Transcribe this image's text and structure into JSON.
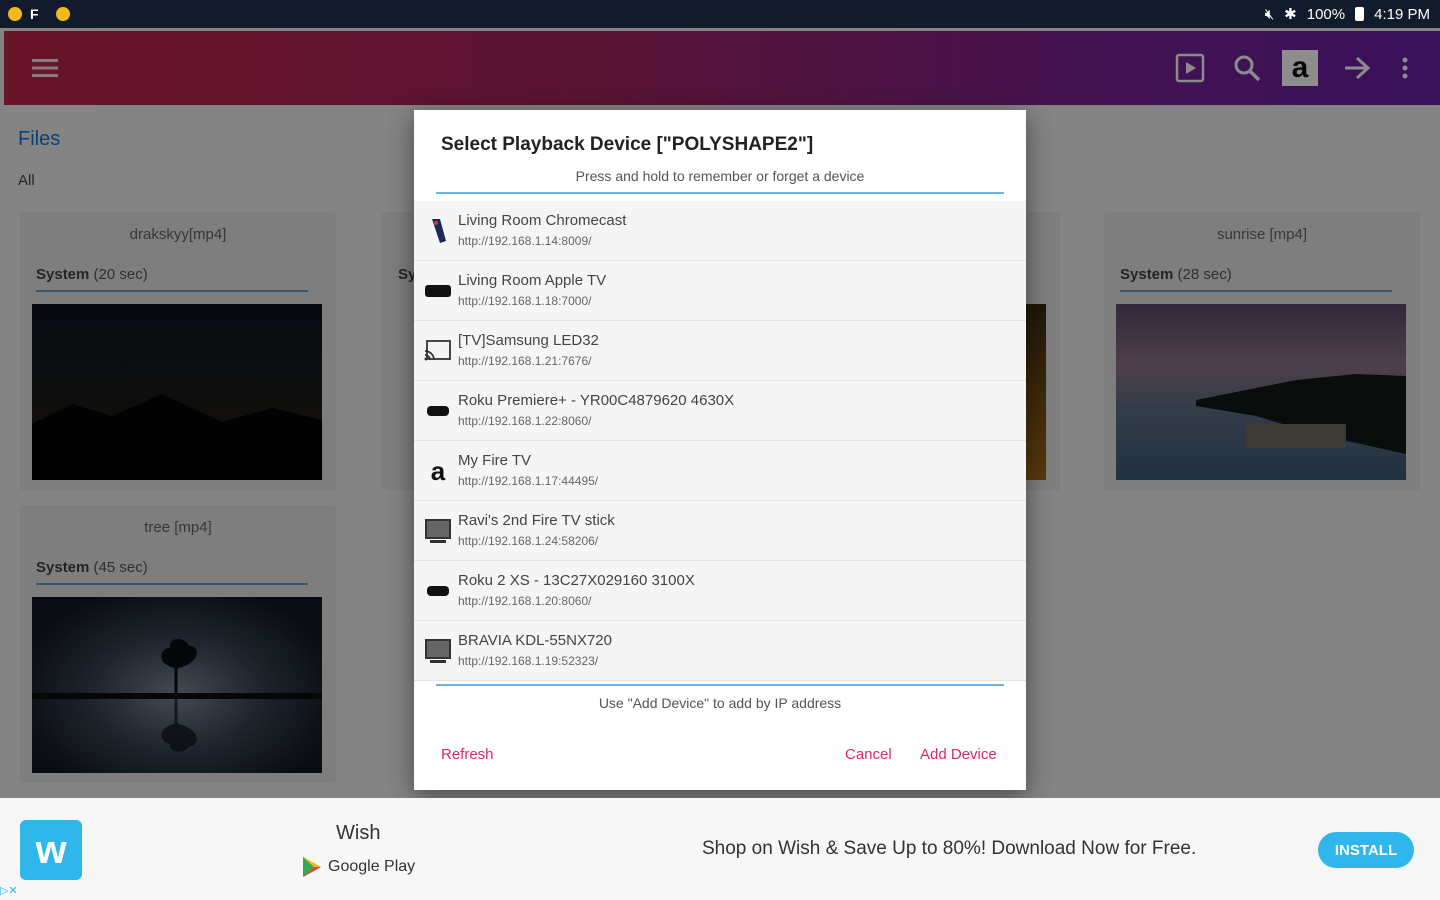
{
  "status_bar": {
    "battery": "100%",
    "time": "4:19 PM",
    "colors": {
      "background": "#111b2b",
      "dots": "#f6b91b"
    },
    "icons": [
      "notification-dot-icon",
      "notification-dot-icon",
      "flipboard-icon",
      "mute-icon",
      "bluetooth-icon",
      "battery-icon"
    ]
  },
  "toolbar": {
    "icons": [
      "menu-icon",
      "play-icon",
      "search-icon",
      "amazon-icon",
      "arrow-right-icon",
      "more-vert-icon"
    ],
    "colors": {
      "gradient_start": "#c1254b",
      "gradient_end": "#6a1fa8"
    }
  },
  "page": {
    "title": "Files",
    "filter": "All",
    "cards": [
      {
        "name": "drakskyy[mp4]",
        "source": "System",
        "duration": "(20 sec)"
      },
      {
        "name": "sunrise [mp4]",
        "source": "System",
        "duration": "(28 sec)"
      },
      {
        "name": "tree [mp4]",
        "source": "System",
        "duration": "(45 sec)"
      },
      {
        "name": "",
        "source": "Sy",
        "duration": ""
      }
    ]
  },
  "dialog": {
    "title": "Select Playback Device [\"POLYSHAPE2\"]",
    "subtitle": "Press and hold to remember or forget a device",
    "devices": [
      {
        "name": "Living Room Chromecast",
        "url": "http://192.168.1.14:8009/",
        "icon": "chromecast-icon"
      },
      {
        "name": "Living Room Apple TV",
        "url": "http://192.168.1.18:7000/",
        "icon": "apple-tv-icon"
      },
      {
        "name": "[TV]Samsung LED32",
        "url": "http://192.168.1.21:7676/",
        "icon": "cast-icon"
      },
      {
        "name": "Roku Premiere+ - YR00C4879620 4630X",
        "url": "http://192.168.1.22:8060/",
        "icon": "roku-icon"
      },
      {
        "name": "My Fire TV",
        "url": "http://192.168.1.17:44495/",
        "icon": "amazon-icon"
      },
      {
        "name": "Ravi's 2nd Fire TV stick",
        "url": "http://192.168.1.24:58206/",
        "icon": "tv-icon"
      },
      {
        "name": "Roku 2 XS - 13C27X029160 3100X",
        "url": "http://192.168.1.20:8060/",
        "icon": "roku-icon"
      },
      {
        "name": "BRAVIA KDL-55NX720",
        "url": "http://192.168.1.19:52323/",
        "icon": "tv-icon"
      }
    ],
    "hint": "Use \"Add Device\" to add by IP address",
    "buttons": {
      "refresh": "Refresh",
      "cancel": "Cancel",
      "add_device": "Add Device"
    },
    "colors": {
      "accent": "#e0266e",
      "divider": "#6db3e0"
    }
  },
  "ad": {
    "app_name": "Wish",
    "store": "Google Play",
    "text": "Shop on Wish & Save Up to 80%! Download Now for Free.",
    "install": "INSTALL",
    "colors": {
      "brand": "#2fb7ec"
    },
    "icons": [
      "wish-logo-icon",
      "google-play-icon",
      "ad-choices-icon"
    ]
  }
}
